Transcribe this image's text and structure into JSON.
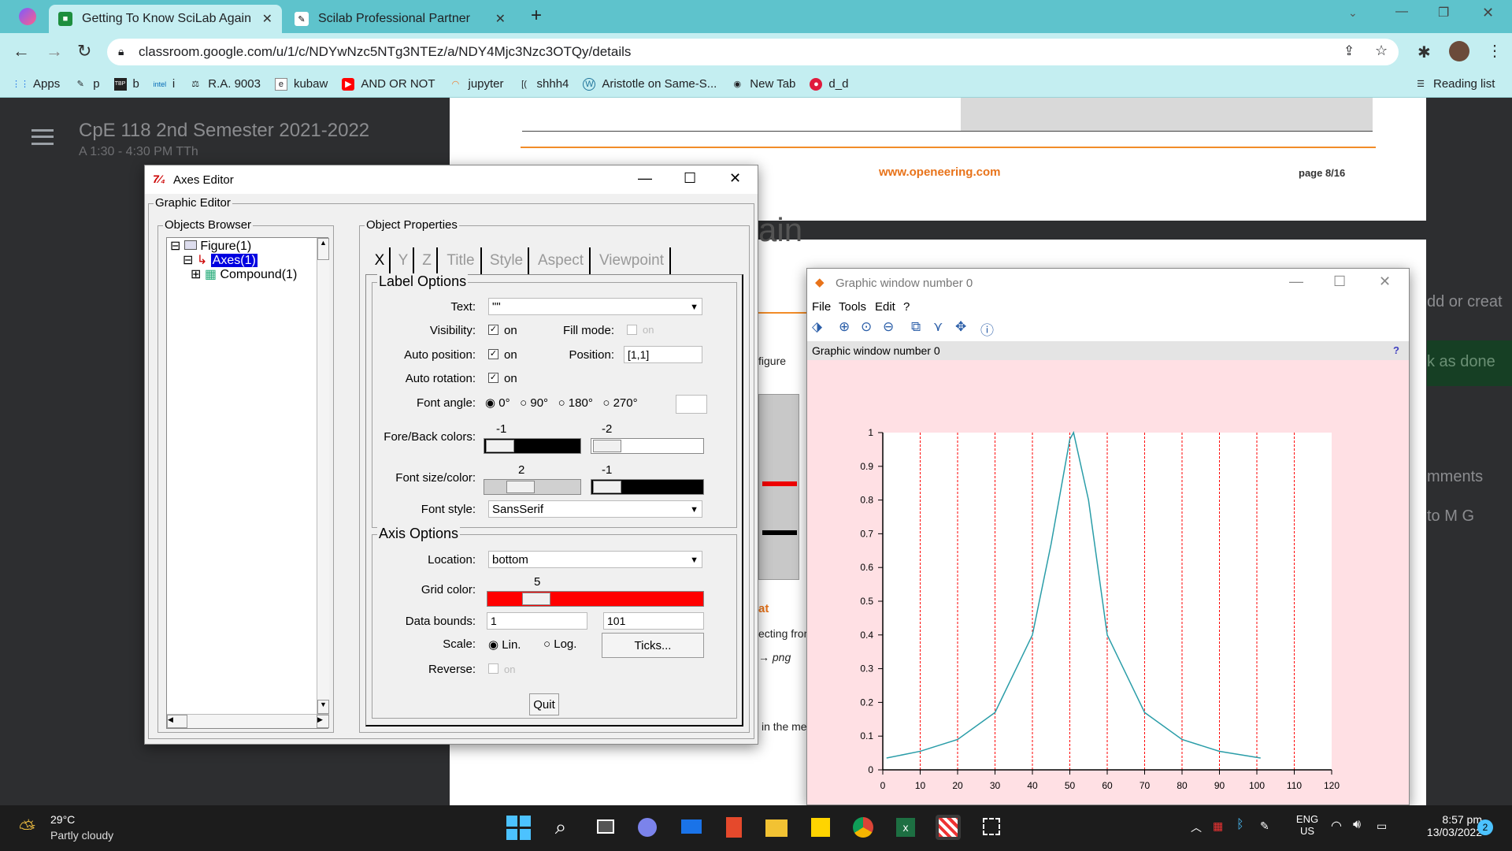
{
  "browser": {
    "tabs": [
      {
        "title": "Getting To Know SciLab Again",
        "active": true
      },
      {
        "title": "Scilab Professional Partner",
        "active": false
      }
    ],
    "url": "classroom.google.com/u/1/c/NDYwNzc5NTg3NTEz/a/NDY4Mjc3Nzc3OTQy/details",
    "bookmarks": [
      "Apps",
      "p",
      "b",
      "i",
      "R.A. 9003",
      "kubaw",
      "AND OR NOT",
      "jupyter",
      "shhh4",
      "Aristotle on Same-S...",
      "New Tab",
      "d_d"
    ],
    "reading_list": "Reading list"
  },
  "classroom": {
    "course_title": "CpE 118 2nd Semester 2021-2022",
    "course_time": "A 1:30 - 4:30 PM TTh",
    "side_texts": [
      "dd or creat",
      "k as done",
      "mments",
      "to M G"
    ]
  },
  "pdf": {
    "website": "www.openeering.com",
    "page": "page 8/16",
    "heading_fragment": "ain",
    "frag_figure": "figure",
    "frag_at": "at",
    "frag_ecting": "ecting fror",
    "frag_png": "png",
    "frag_inme": "in the me"
  },
  "axes_editor": {
    "title": "Axes Editor",
    "graphic_editor": "Graphic Editor",
    "objects_browser": "Objects Browser",
    "tree": [
      "Figure(1)",
      "Axes(1)",
      "Compound(1)"
    ],
    "object_properties": "Object Properties",
    "tabs": [
      "X",
      "Y",
      "Z",
      "Title",
      "Style",
      "Aspect",
      "Viewpoint"
    ],
    "label_options": "Label Options",
    "text_label": "Text:",
    "text_value": "\"\"",
    "visibility_label": "Visibility:",
    "on": "on",
    "fill_mode_label": "Fill mode:",
    "auto_position_label": "Auto position:",
    "position_label": "Position:",
    "position_value": "[1,1]",
    "auto_rotation_label": "Auto rotation:",
    "font_angle_label": "Font angle:",
    "angles": [
      "0°",
      "90°",
      "180°",
      "270°"
    ],
    "fore_back_label": "Fore/Back colors:",
    "fore_value": "-1",
    "back_value": "-2",
    "font_size_color_label": "Font size/color:",
    "font_size_value": "2",
    "font_color_value": "-1",
    "font_style_label": "Font style:",
    "font_style_value": "SansSerif",
    "axis_options": "Axis Options",
    "location_label": "Location:",
    "location_value": "bottom",
    "grid_color_label": "Grid color:",
    "grid_color_value": "5",
    "data_bounds_label": "Data bounds:",
    "data_bounds_min": "1",
    "data_bounds_max": "101",
    "scale_label": "Scale:",
    "scale_lin": "Lin.",
    "scale_log": "Log.",
    "ticks_button": "Ticks...",
    "reverse_label": "Reverse:",
    "quit_button": "Quit"
  },
  "graphic_window": {
    "title": "Graphic window number 0",
    "menu": [
      "File",
      "Tools",
      "Edit",
      "?"
    ],
    "header": "Graphic window number 0",
    "help": "?"
  },
  "chart_data": {
    "type": "line",
    "x": [
      1,
      10,
      20,
      30,
      40,
      45,
      50,
      51,
      55,
      60,
      70,
      80,
      90,
      101
    ],
    "y": [
      0.035,
      0.055,
      0.09,
      0.17,
      0.4,
      0.67,
      0.98,
      1.0,
      0.8,
      0.4,
      0.17,
      0.09,
      0.055,
      0.035
    ],
    "xlim": [
      0,
      120
    ],
    "ylim": [
      0,
      1
    ],
    "xticks": [
      "0",
      "10",
      "20",
      "30",
      "40",
      "50",
      "60",
      "70",
      "80",
      "90",
      "100",
      "110",
      "120"
    ],
    "yticks": [
      "0",
      "0.1",
      "0.2",
      "0.3",
      "0.4",
      "0.5",
      "0.6",
      "0.7",
      "0.8",
      "0.9",
      "1"
    ],
    "line_color": "#2a9da8",
    "grid_color": "#ff0000",
    "background": "#ffe0e4",
    "grid": "vertical"
  },
  "taskbar": {
    "temperature": "29°C",
    "weather": "Partly cloudy",
    "lang1": "ENG",
    "lang2": "US",
    "time": "8:57 pm",
    "date": "13/03/2022",
    "notifications": "2"
  }
}
